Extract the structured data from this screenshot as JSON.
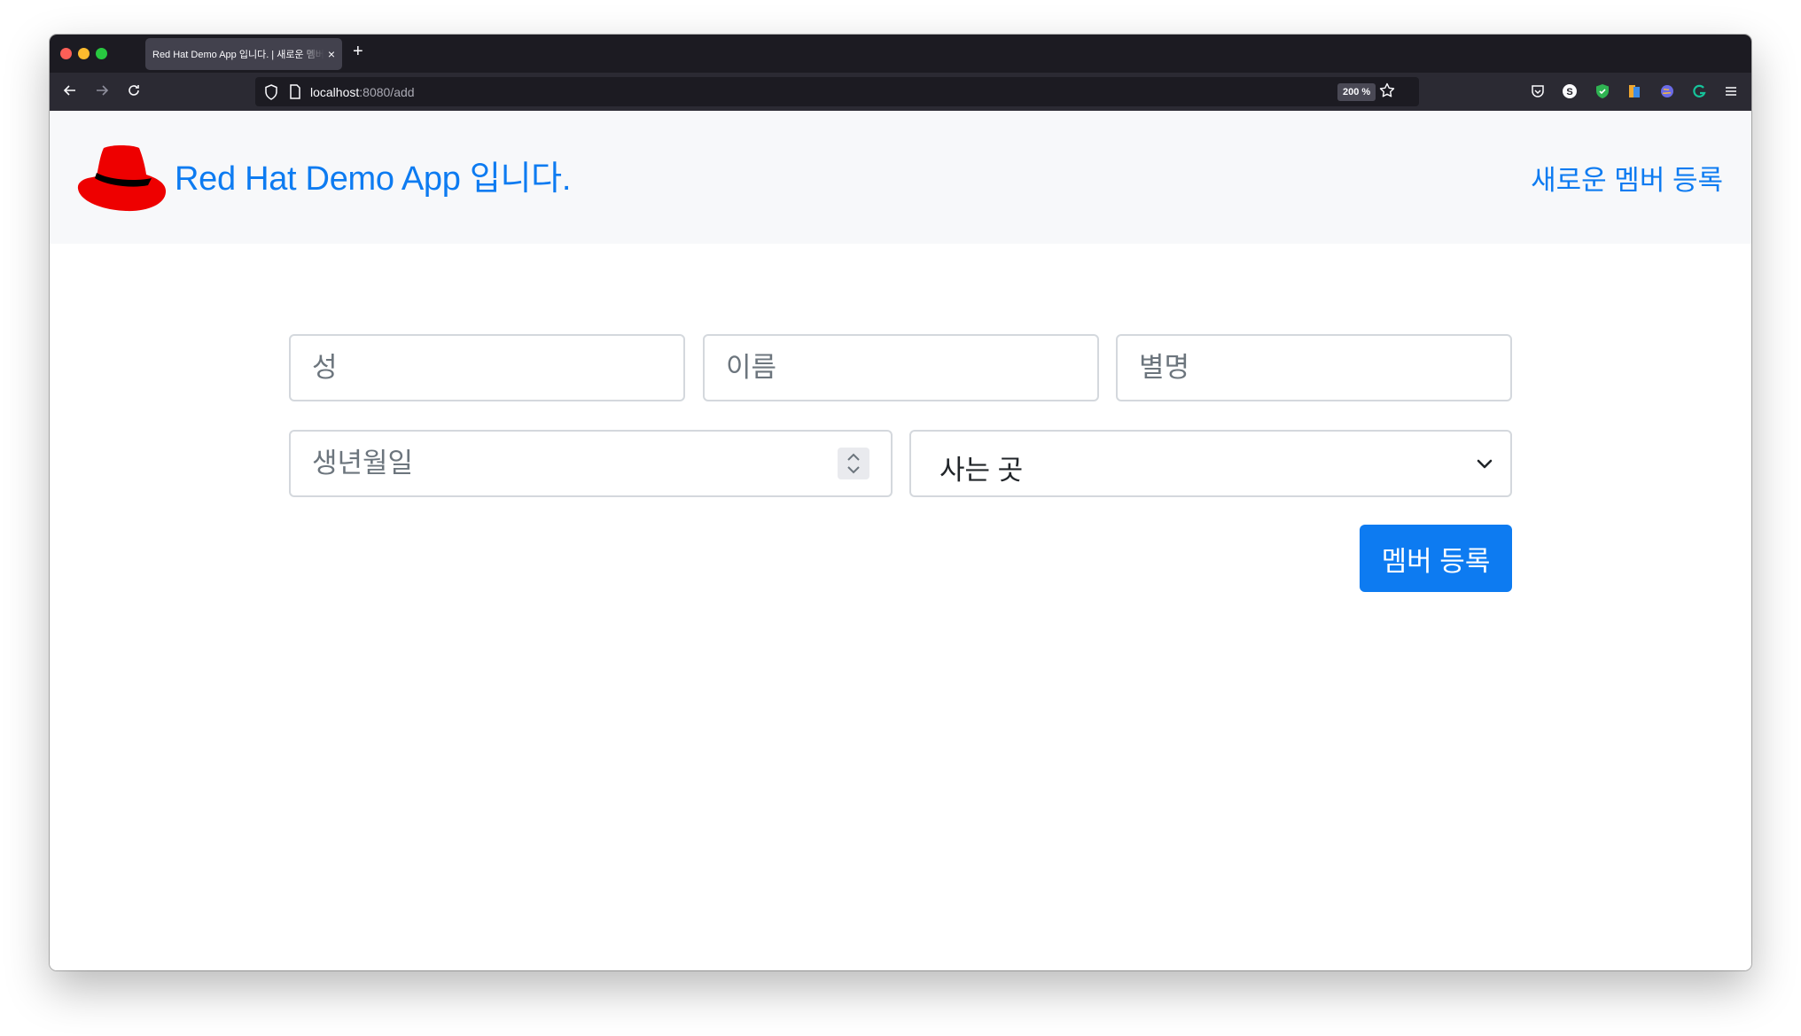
{
  "browser": {
    "tab_title": "Red Hat Demo App 입니다. | 새로운 멤버 등록",
    "new_tab_label": "+",
    "tab_close_label": "×",
    "url_host": "localhost",
    "url_rest": ":8080/add",
    "zoom": "200 %"
  },
  "header": {
    "brand": "Red Hat Demo App 입니다.",
    "nav_link": "새로운 멤버 등록"
  },
  "form": {
    "last_name_placeholder": "성",
    "first_name_placeholder": "이름",
    "nickname_placeholder": "별명",
    "birthdate_placeholder": "생년월일",
    "residence_selected": "사는 곳",
    "submit_label": "멤버 등록"
  },
  "colors": {
    "accent": "#0d7bf1",
    "logo_red": "#ee0000",
    "header_bg": "#f7f8fa"
  }
}
